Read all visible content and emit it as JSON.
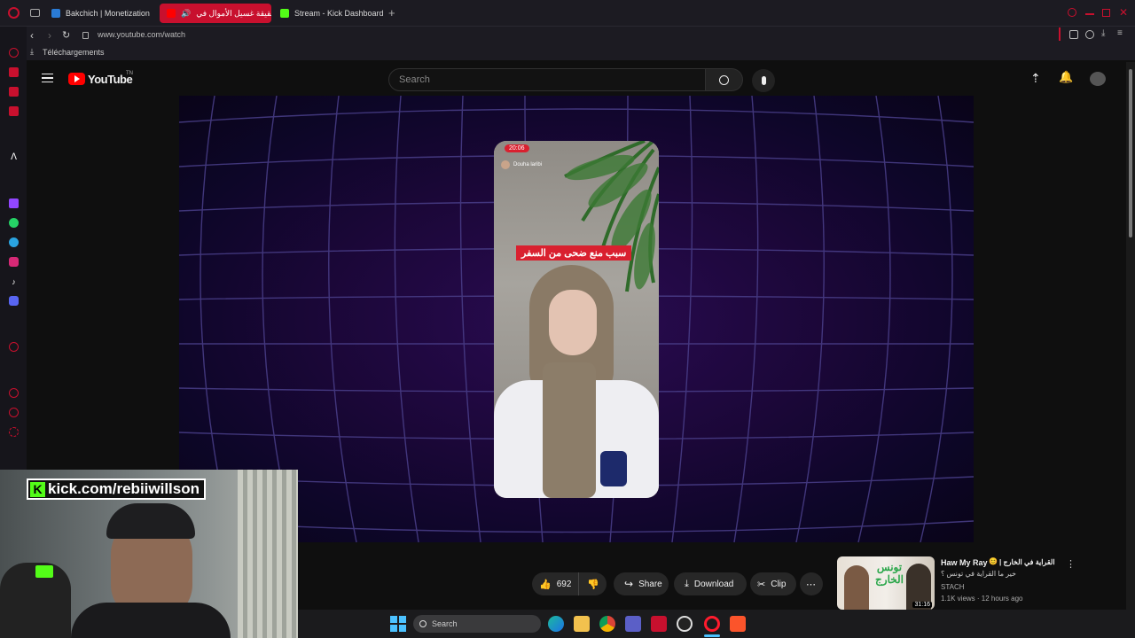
{
  "browser": {
    "tabs": [
      {
        "label": "Bakchich | Monetization"
      },
      {
        "label": "حقيقة غسيل الأموال في"
      },
      {
        "label": "Stream - Kick Dashboard"
      }
    ],
    "url": "www.youtube.com/watch",
    "bookmark": "Téléchargements"
  },
  "youtube": {
    "logo_text": "YouTube",
    "region": "TN",
    "search_placeholder": "Search"
  },
  "video": {
    "phone_time": "20:06",
    "creator_handle": "Douha laribi",
    "caption": "سبب منع ضحى من السفر"
  },
  "actions": {
    "likes": "692",
    "share": "Share",
    "download": "Download",
    "clip": "Clip"
  },
  "suggestion": {
    "title_en": "Haw My Ray",
    "title_ar": "القراية في الخارج |",
    "subtitle": "خير ما القراية في تونس ؟",
    "channel": "STACH",
    "stats": "1.1K views · 12 hours ago",
    "duration": "31:16",
    "thumb_text": "تونس الخارج"
  },
  "webcam": {
    "overlay_text": "kick.com/rebiiwillson"
  },
  "taskbar": {
    "search_label": "Search"
  },
  "colors": {
    "opera_red": "#c8102e",
    "kick_green": "#53fc18",
    "youtube_red": "#ff0000"
  }
}
